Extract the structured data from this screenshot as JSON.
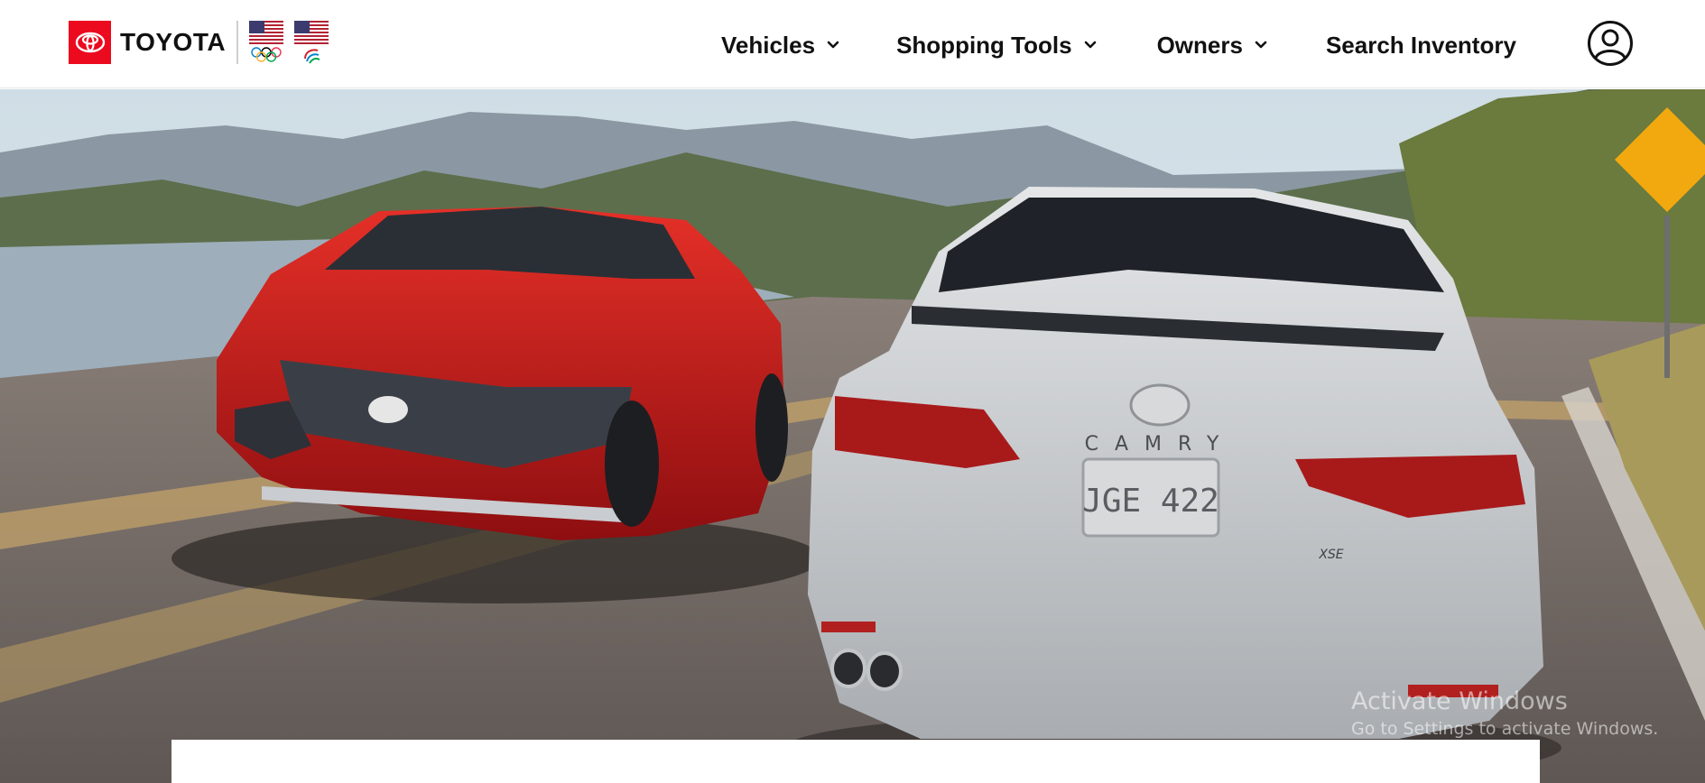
{
  "brand": {
    "name": "TOYOTA",
    "accent_color": "#eb0a1e",
    "logo_icon": "toyota-emblem-icon",
    "flags": [
      {
        "icon": "us-flag-olympic-icon"
      },
      {
        "icon": "us-flag-paralympic-icon"
      }
    ]
  },
  "nav": {
    "items": [
      {
        "label": "Vehicles",
        "icon": "chevron-down-icon"
      },
      {
        "label": "Shopping Tools",
        "icon": "chevron-down-icon"
      },
      {
        "label": "Owners",
        "icon": "chevron-down-icon"
      },
      {
        "label": "Search Inventory"
      }
    ],
    "account_icon": "user-account-icon"
  },
  "hero": {
    "plate_text": "JGE 422",
    "badge_text": "CAMRY",
    "trim_text": "XSE"
  },
  "watermark": {
    "line1": "Activate Windows",
    "line2": "Go to Settings to activate Windows."
  }
}
